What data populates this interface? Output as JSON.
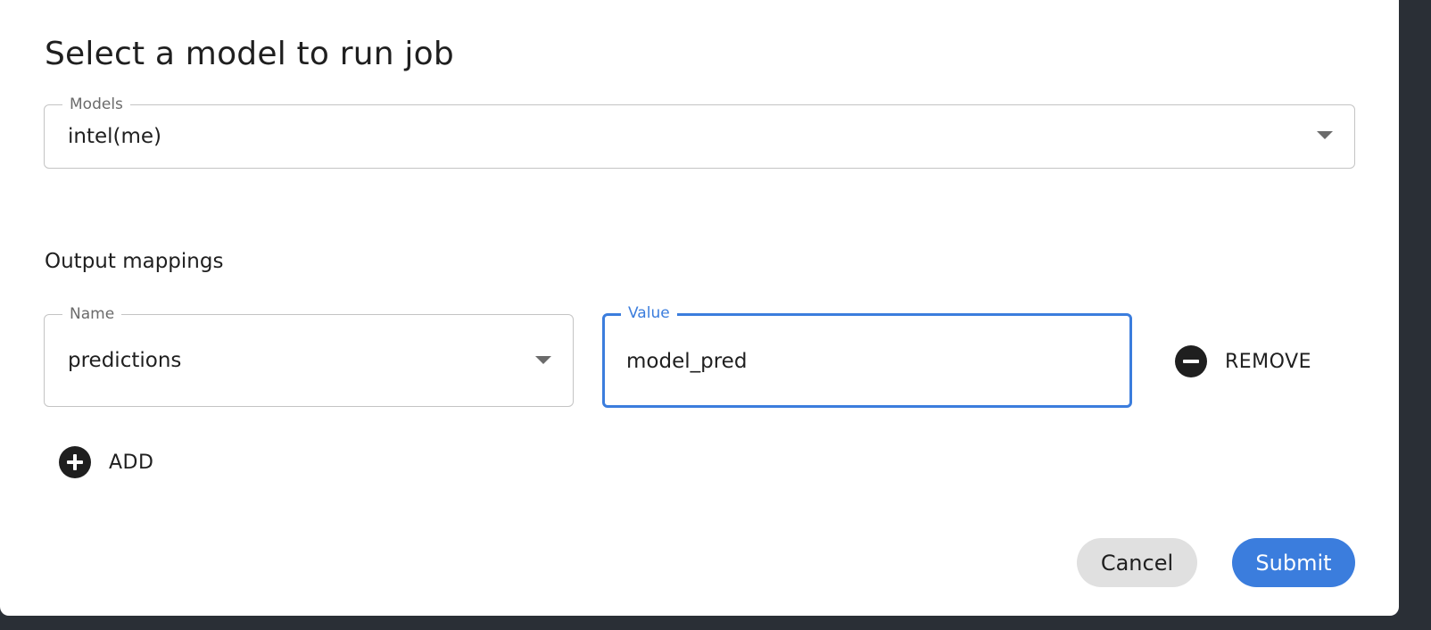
{
  "dialog": {
    "title": "Select a model to run job",
    "models_field": {
      "legend": "Models",
      "value": "intel(me)"
    },
    "output_mappings": {
      "label": "Output mappings",
      "name_field": {
        "legend": "Name",
        "value": "predictions"
      },
      "value_field": {
        "legend": "Value",
        "value": "model_pred"
      },
      "remove_label": "REMOVE",
      "add_label": "ADD"
    },
    "actions": {
      "cancel_label": "Cancel",
      "submit_label": "Submit"
    }
  },
  "colors": {
    "accent": "#3b7ddd",
    "cancel_bg": "#e0e0e0",
    "text": "#1f1f1f"
  },
  "icons": {
    "dropdown": "caret-down-icon",
    "remove": "minus-circle-icon",
    "add": "plus-circle-icon"
  }
}
